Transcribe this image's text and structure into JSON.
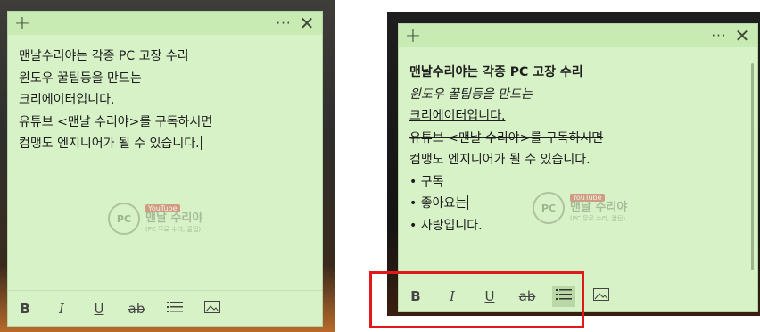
{
  "title_bar": {
    "add_glyph": "+",
    "more_glyph": "···",
    "close_glyph": "✕"
  },
  "left_note": {
    "lines": [
      "맨날수리야는 각종 PC 고장 수리",
      "윈도우 꿀팁등을 만드는",
      "크리에이터입니다.",
      "유튜브 <맨날 수리야>를 구독하시면",
      "컴맹도 엔지니어가 될 수 있습니다."
    ]
  },
  "right_note": {
    "line_bold": "맨날수리야는 각종 PC 고장 수리",
    "line_italic": "윈도우 꿀팁등을 만드는",
    "line_underline": "크리에이터입니다.",
    "line_strike": "유튜브 <맨날 수리야>를 구독하시면",
    "line_plain": "컴맹도 엔지니어가 될 수 있습니다.",
    "bullets": [
      "• 구독",
      "• 좋아요는",
      "• 사랑입니다."
    ]
  },
  "watermark": {
    "logo_text": "PC",
    "badge": "YouTube",
    "title": "맨날 수리야",
    "subtitle": "(PC 무료 수리, 꿀팁)"
  },
  "format_toolbar": {
    "bold": "B",
    "italic": "I",
    "underline": "U",
    "strikethrough": "ab",
    "bullets_glyph": "☰",
    "image_glyph": "🖼"
  },
  "colors": {
    "note_bg": "#d8f2c8",
    "titlebar_bg": "#c8ebb3",
    "highlight": "#e01a1a"
  },
  "state": {
    "bullets_active": true
  }
}
